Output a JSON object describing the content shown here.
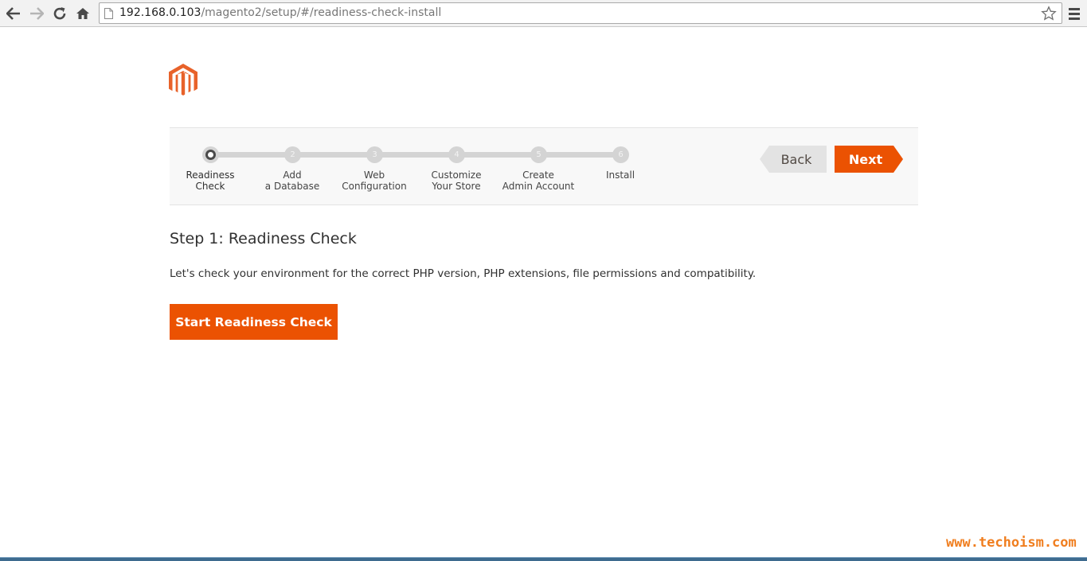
{
  "browser": {
    "url_host": "192.168.0.103",
    "url_path": "/magento2/setup/#/readiness-check-install"
  },
  "wizard": {
    "steps": [
      {
        "number": "",
        "line1": "Readiness",
        "line2": "Check",
        "active": true
      },
      {
        "number": "2",
        "line1": "Add",
        "line2": "a Database",
        "active": false
      },
      {
        "number": "3",
        "line1": "Web",
        "line2": "Configuration",
        "active": false
      },
      {
        "number": "4",
        "line1": "Customize",
        "line2": "Your Store",
        "active": false
      },
      {
        "number": "5",
        "line1": "Create",
        "line2": "Admin Account",
        "active": false
      },
      {
        "number": "6",
        "line1": "Install",
        "line2": "",
        "active": false
      }
    ],
    "back_label": "Back",
    "next_label": "Next"
  },
  "content": {
    "title": "Step 1: Readiness Check",
    "description": "Let's check your environment for the correct PHP version, PHP extensions, file permissions and compatibility.",
    "start_button": "Start Readiness Check"
  },
  "watermark": "www.techoism.com",
  "colors": {
    "brand_orange": "#eb5202",
    "logo_orange": "#e8622a",
    "watermark_orange": "#f07e1f"
  },
  "icons": [
    "back-arrow-icon",
    "forward-arrow-icon",
    "reload-icon",
    "home-icon",
    "page-icon",
    "star-icon",
    "menu-icon",
    "magento-logo-icon"
  ]
}
